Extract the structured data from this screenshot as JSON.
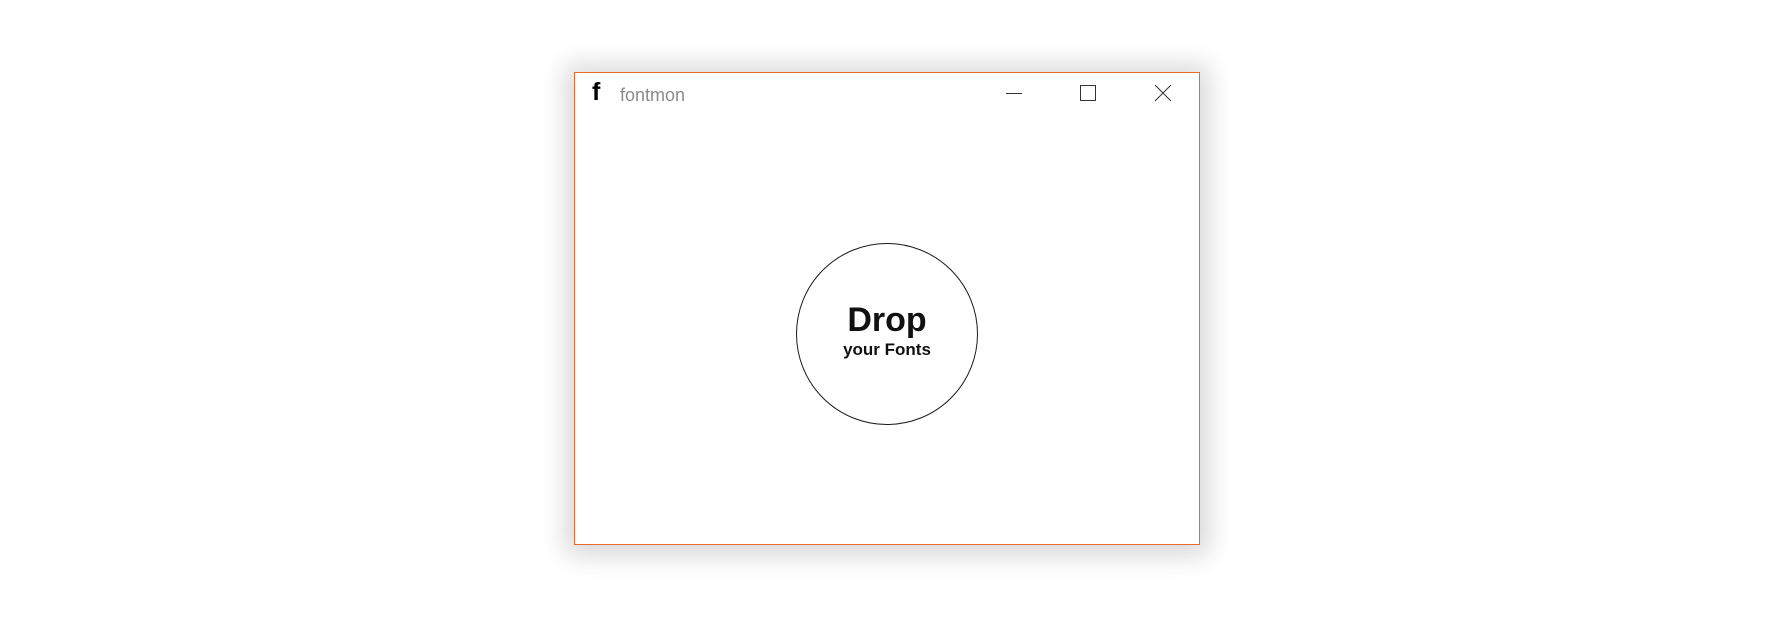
{
  "window": {
    "app_icon_glyph": "f",
    "title": "fontmon",
    "border_color": "#e8692f",
    "controls": {
      "minimize": "minimize-icon",
      "maximize": "maximize-icon",
      "close": "close-icon"
    }
  },
  "drop_zone": {
    "title": "Drop",
    "subtitle": "your Fonts"
  }
}
